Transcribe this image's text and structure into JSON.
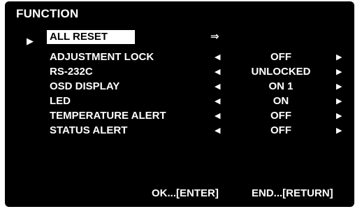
{
  "menu": {
    "title": "FUNCTION",
    "selection_marker": "▶",
    "items": [
      {
        "label": "ALL RESET",
        "left_arrow": "",
        "value": "",
        "right_arrow": "",
        "action_arrow": "⇒"
      },
      {
        "label": "ADJUSTMENT LOCK",
        "left_arrow": "◀",
        "value": "OFF",
        "right_arrow": "▶"
      },
      {
        "label": "RS-232C",
        "left_arrow": "◀",
        "value": "UNLOCKED",
        "right_arrow": "▶"
      },
      {
        "label": "OSD DISPLAY",
        "left_arrow": "◀",
        "value": "ON 1",
        "right_arrow": "▶"
      },
      {
        "label": "LED",
        "left_arrow": "◀",
        "value": "ON",
        "right_arrow": "▶"
      },
      {
        "label": "TEMPERATURE ALERT",
        "left_arrow": "◀",
        "value": "OFF",
        "right_arrow": "▶"
      },
      {
        "label": "STATUS ALERT",
        "left_arrow": "◀",
        "value": "OFF",
        "right_arrow": "▶"
      }
    ]
  },
  "footer": {
    "ok_label": "OK...[ENTER]",
    "end_label": "END...[RETURN]"
  },
  "colors": {
    "background": "#000000",
    "text": "#ffffff",
    "highlight": "#ffffff",
    "highlight_text": "#000000"
  }
}
